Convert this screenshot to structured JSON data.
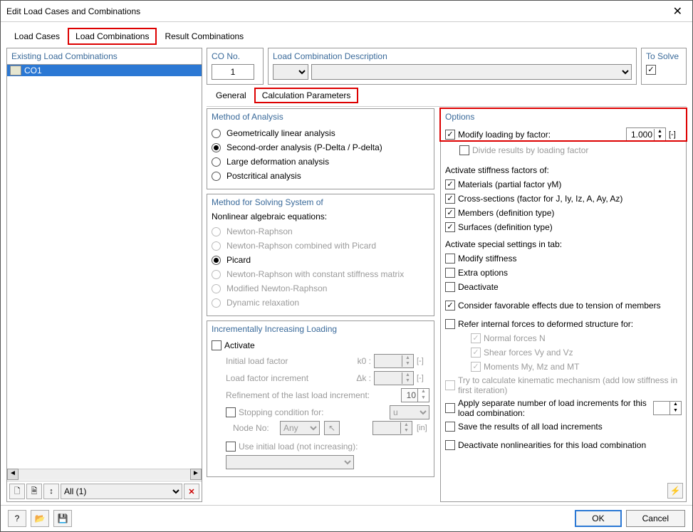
{
  "window": {
    "title": "Edit Load Cases and Combinations"
  },
  "main_tabs": {
    "load_cases": "Load Cases",
    "load_combinations": "Load Combinations",
    "result_combinations": "Result Combinations"
  },
  "existing": {
    "header": "Existing Load Combinations",
    "items": [
      "CO1"
    ]
  },
  "left_toolbar": {
    "filter": "All (1)"
  },
  "top": {
    "co_no_label": "CO No.",
    "co_no_value": "1",
    "lc_desc_label": "Load Combination Description",
    "to_solve_label": "To Solve"
  },
  "sub_tabs": {
    "general": "General",
    "calc_params": "Calculation Parameters"
  },
  "method_analysis": {
    "header": "Method of Analysis",
    "geo_linear": "Geometrically linear analysis",
    "second_order": "Second-order analysis (P-Delta / P-delta)",
    "large_def": "Large deformation analysis",
    "postcrit": "Postcritical analysis"
  },
  "method_solving": {
    "header": "Method for Solving System of",
    "sub": "Nonlinear algebraic equations:",
    "newton_raphson": "Newton-Raphson",
    "nr_picard": "Newton-Raphson combined with Picard",
    "picard": "Picard",
    "nr_const": "Newton-Raphson with constant stiffness matrix",
    "mod_nr": "Modified Newton-Raphson",
    "dyn_relax": "Dynamic relaxation"
  },
  "incremental": {
    "header": "Incrementally Increasing Loading",
    "activate": "Activate",
    "initial_lf": "Initial load factor",
    "k0": "k0 :",
    "lf_increment": "Load factor increment",
    "dk": "Δk :",
    "refinement": "Refinement of the last load increment:",
    "refine_val": "10",
    "stop_cond": "Stopping condition for:",
    "stop_sel": "u",
    "node_no": "Node No:",
    "node_any": "Any",
    "use_initial": "Use initial load (not increasing):",
    "unit_none": "[-]",
    "unit_in": "[in]"
  },
  "options": {
    "header": "Options",
    "modify_loading": "Modify loading by factor:",
    "modify_val": "1.000",
    "divide_results": "Divide results by loading factor",
    "activate_stiff": "Activate stiffness factors of:",
    "materials": "Materials (partial factor γM)",
    "cross_sections": "Cross-sections (factor for J, Iy, Iz, A, Ay, Az)",
    "members": "Members (definition type)",
    "surfaces": "Surfaces (definition type)",
    "activate_special": "Activate special settings in tab:",
    "modify_stiff": "Modify stiffness",
    "extra_opts": "Extra options",
    "deactivate": "Deactivate",
    "favorable": "Consider favorable effects due to tension of members",
    "refer_internal": "Refer internal forces to deformed structure for:",
    "normal_forces": "Normal forces N",
    "shear_forces": "Shear forces Vy and Vz",
    "moments": "Moments My, Mz and MT",
    "kinematic": "Try to calculate kinematic mechanism (add low stiffness in first iteration)",
    "separate_inc": "Apply separate number of load increments for this load combination:",
    "save_results": "Save the results of all load increments",
    "deact_nonlin": "Deactivate nonlinearities for this load combination"
  },
  "footer": {
    "ok": "OK",
    "cancel": "Cancel"
  }
}
